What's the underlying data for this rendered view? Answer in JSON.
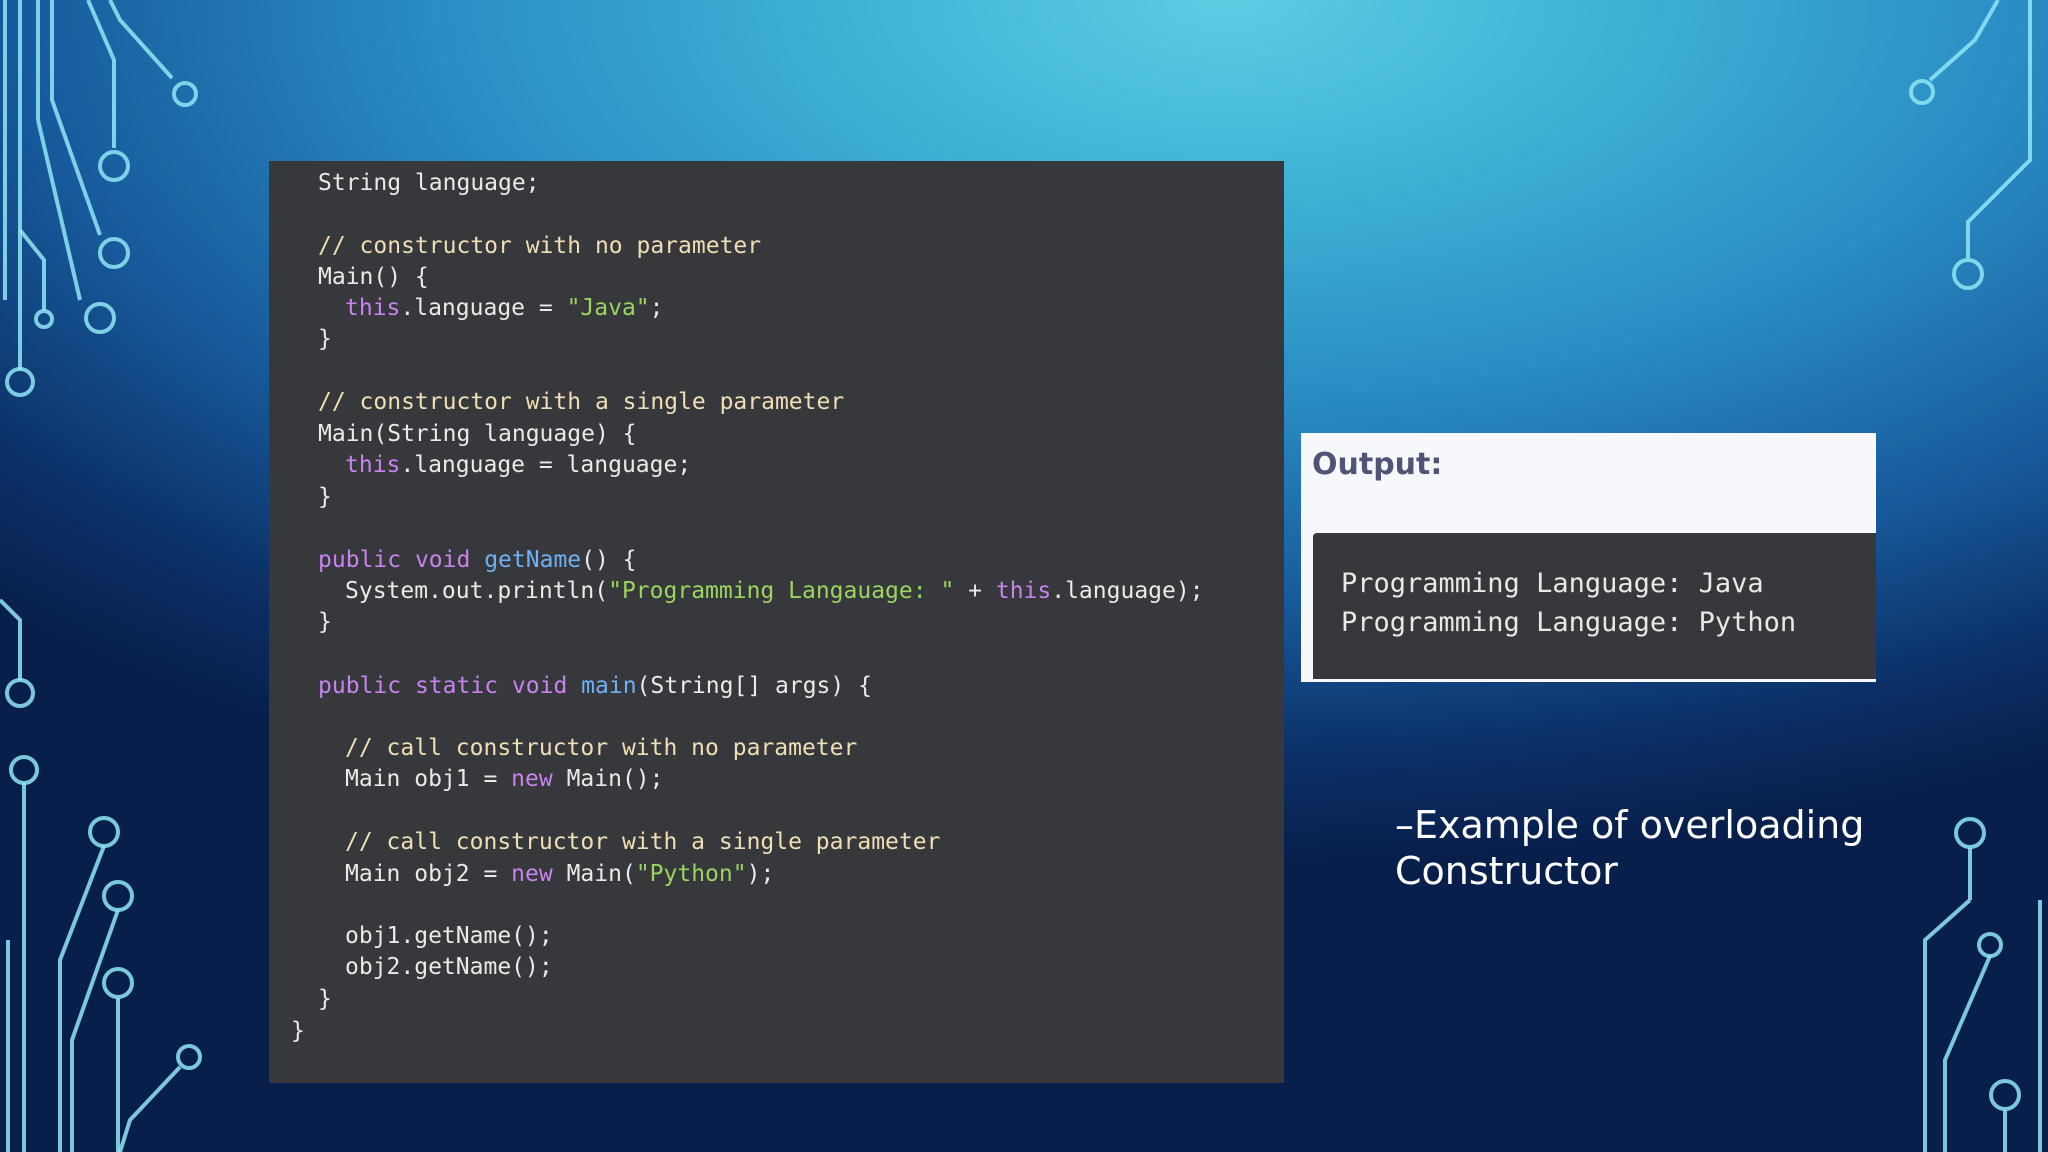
{
  "code": {
    "line_string_language": "String language;",
    "cm_no_param": "// constructor with no parameter",
    "main_open": "Main() {",
    "this_kw_1": "this",
    "assign_java_mid": ".language = ",
    "java_str": "\"Java\"",
    "semicolon": ";",
    "close_brace": "}",
    "cm_single_param": "// constructor with a single parameter",
    "main_string_open": "Main(String language) {",
    "this_kw_2": "this",
    "assign_language": ".language = language;",
    "public_kw": "public",
    "void_kw": "void",
    "getname_fn": "getName",
    "getname_rest": "() {",
    "println_start": "System.out.println(",
    "println_str": "\"Programming Langauage: \"",
    "println_plus": " + ",
    "this_kw_3": "this",
    "println_end": ".language);",
    "static_kw": "static",
    "main_fn": "main",
    "main_args": "(String[] args) {",
    "cm_call_no": "// call constructor with no parameter",
    "obj1_decl_start": "Main obj1 = ",
    "new_kw": "new",
    "obj1_decl_end": " Main();",
    "cm_call_single": "// call constructor with a single parameter",
    "obj2_decl_start": "Main obj2 = ",
    "obj2_decl_mid": " Main(",
    "python_str": "\"Python\"",
    "obj2_decl_end": ");",
    "obj1_call": "obj1.getName();",
    "obj2_call": "obj2.getName();"
  },
  "output": {
    "title": "Output:",
    "lines": [
      "Programming Language: Java",
      "Programming Language: Python"
    ]
  },
  "caption": {
    "line1": "–Example of overloading",
    "line2": "Constructor"
  },
  "colors": {
    "comment": "#f0dfb4",
    "keyword": "#c883ec",
    "function": "#6fb0f5",
    "string": "#9bd55f",
    "panel": "#36383b"
  }
}
